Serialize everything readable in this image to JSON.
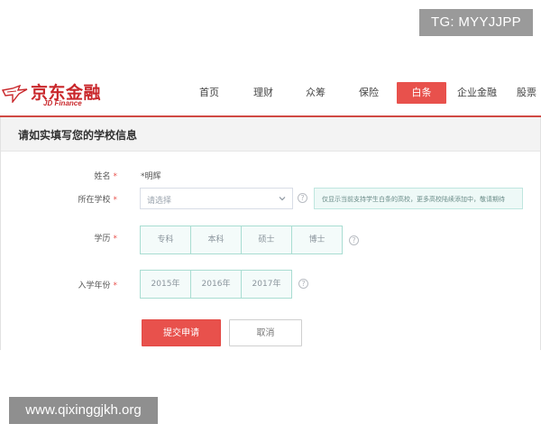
{
  "badge": {
    "text": "TG: MYYJJPP"
  },
  "logo": {
    "cn": "京东金融",
    "en": "JD Finance"
  },
  "nav": {
    "items": [
      "首页",
      "理财",
      "众筹",
      "保险",
      "白条",
      "企业金融",
      "股票"
    ],
    "active_index": 4
  },
  "section": {
    "title": "请如实填写您的学校信息"
  },
  "form": {
    "name_label": "姓名",
    "name_value": "*明辉",
    "school_label": "所在学校",
    "school_placeholder": "请选择",
    "school_tip": "仅显示当前支持学生白条的高校，更多高校陆续添加中，敬请期待",
    "degree_label": "学历",
    "degree_options": [
      "专科",
      "本科",
      "硕士",
      "博士"
    ],
    "year_label": "入学年份",
    "year_options": [
      "2015年",
      "2016年",
      "2017年"
    ],
    "required_mark": "*",
    "help_mark": "?"
  },
  "buttons": {
    "submit": "提交申请",
    "cancel": "取消"
  },
  "watermark": {
    "text": "www.qixinggjkh.org"
  },
  "colors": {
    "brand_red": "#c9272b",
    "accent": "#e8514c",
    "option_border": "#a9ddd2",
    "tip_bg": "#eef9f7"
  }
}
